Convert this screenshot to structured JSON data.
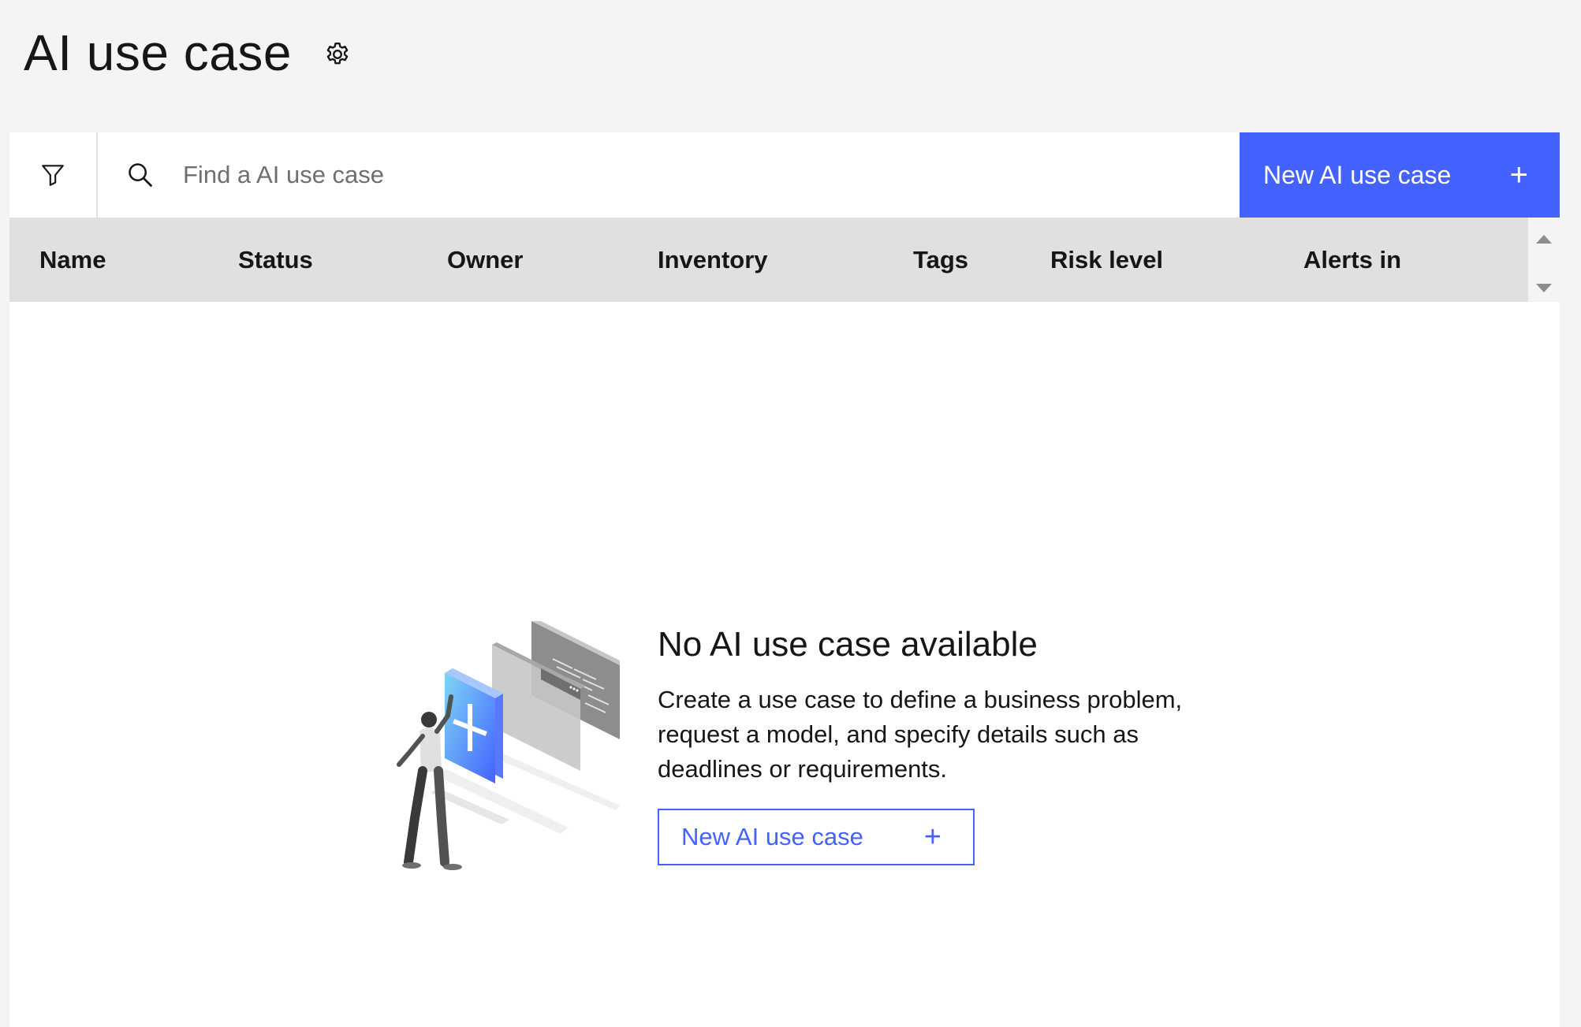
{
  "page": {
    "title": "AI use case"
  },
  "toolbar": {
    "search_placeholder": "Find a AI use case",
    "new_button_label": "New AI use case",
    "new_button_icon": "+"
  },
  "table": {
    "columns": [
      "Name",
      "Status",
      "Owner",
      "Inventory",
      "Tags",
      "Risk level",
      "Alerts in"
    ]
  },
  "empty_state": {
    "title": "No AI use case available",
    "description": "Create a use case to define a business problem, request a model, and specify details such as deadlines or requirements.",
    "button_label": "New AI use case",
    "button_icon": "+"
  },
  "colors": {
    "accent": "#4362ff",
    "page_background": "#f4f4f4",
    "header_row": "#e0e0e0",
    "panel": "#ffffff"
  },
  "icons": [
    "gear-icon",
    "filter-icon",
    "search-icon",
    "plus-icon",
    "chevron-up-icon",
    "chevron-down-icon"
  ]
}
